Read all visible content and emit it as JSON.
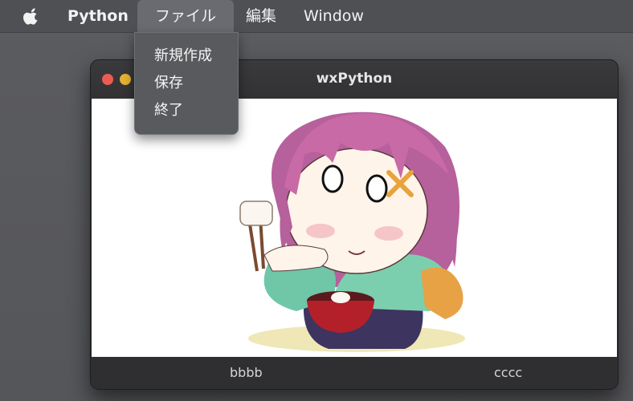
{
  "menubar": {
    "app_name": "Python",
    "items": [
      "ファイル",
      "編集",
      "Window"
    ],
    "active_item": "ファイル"
  },
  "file_menu": {
    "items": [
      "新規作成",
      "保存",
      "終了"
    ]
  },
  "window": {
    "title": "wxPython",
    "image": "chibi-girl-eating-mochi",
    "status_fields": [
      "bbbb",
      "cccc"
    ]
  },
  "colors": {
    "menubar_bg": "#4f5054",
    "dropdown_bg": "#585a5d",
    "window_bg": "#2b2b2c",
    "close_button": "#ec5b53",
    "minimize_button": "#e4b131"
  }
}
